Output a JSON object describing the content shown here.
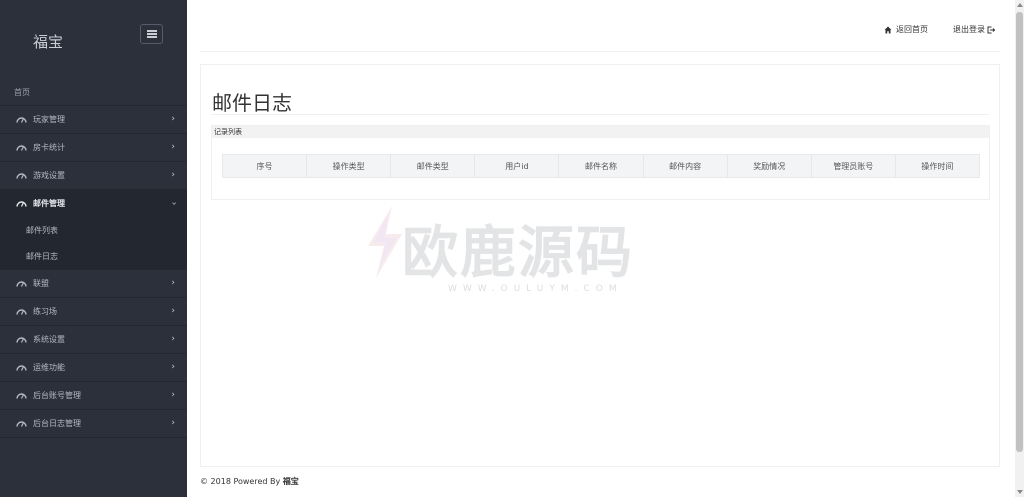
{
  "sidebar": {
    "brand": "福宝",
    "home": "首页",
    "items": [
      {
        "label": "玩家管理",
        "expanded": false
      },
      {
        "label": "房卡统计",
        "expanded": false
      },
      {
        "label": "游戏设置",
        "expanded": false
      },
      {
        "label": "邮件管理",
        "expanded": true,
        "children": [
          "邮件列表",
          "邮件日志"
        ]
      },
      {
        "label": "联盟",
        "expanded": false
      },
      {
        "label": "练习场",
        "expanded": false
      },
      {
        "label": "系统设置",
        "expanded": false
      },
      {
        "label": "运维功能",
        "expanded": false
      },
      {
        "label": "后台账号管理",
        "expanded": false
      },
      {
        "label": "后台日志管理",
        "expanded": false
      }
    ]
  },
  "topbar": {
    "home_label": "返回首页",
    "logout_label": "退出登录"
  },
  "main": {
    "title": "邮件日志",
    "list_title": "记录列表",
    "columns": [
      "序号",
      "操作类型",
      "邮件类型",
      "用户id",
      "邮件名称",
      "邮件内容",
      "奖励情况",
      "管理员账号",
      "操作时间"
    ]
  },
  "watermark": {
    "text": "欧鹿源码",
    "url": "WWW.OULUYM.COM"
  },
  "footer": {
    "prefix": "© 2018 Powered By",
    "brand": "福宝"
  },
  "colors": {
    "sidebar_bg": "#2b303b",
    "sidebar_active_bg": "#232730"
  }
}
